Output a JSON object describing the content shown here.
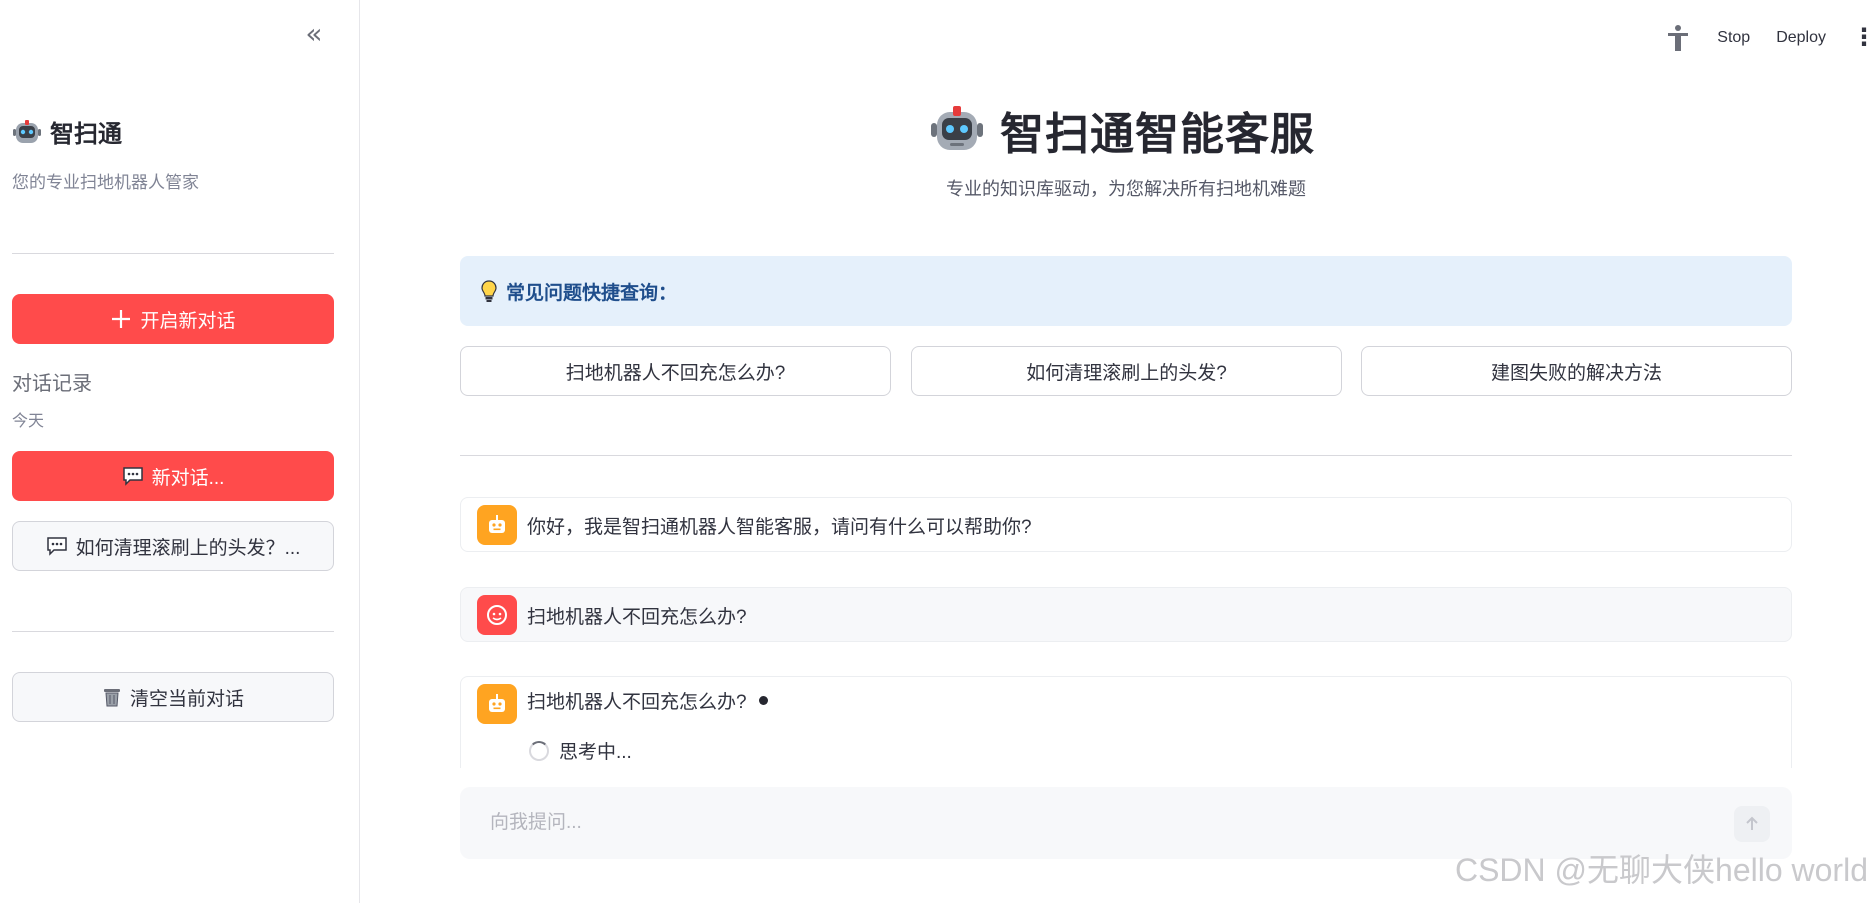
{
  "sidebar": {
    "collapse_glyph": "«",
    "brand_title": "智扫通",
    "brand_subtitle": "您的专业扫地机器人管家",
    "new_chat_button": "开启新对话",
    "history_title": "对话记录",
    "history_group": "今天",
    "history_items": [
      "新对话...",
      "如何清理滚刷上的头发？..."
    ],
    "clear_button": "清空当前对话"
  },
  "topbar": {
    "stop_label": "Stop",
    "deploy_label": "Deploy"
  },
  "main": {
    "title": "智扫通智能客服",
    "subtitle": "专业的知识库驱动，为您解决所有扫地机难题",
    "faq_header": "常见问题快捷查询：",
    "faq_buttons": [
      "扫地机器人不回充怎么办?",
      "如何清理滚刷上的头发?",
      "建图失败的解决方法"
    ]
  },
  "messages": [
    {
      "role": "assistant",
      "text": "你好，我是智扫通机器人智能客服，请问有什么可以帮助你?"
    },
    {
      "role": "user",
      "text": "扫地机器人不回充怎么办?"
    },
    {
      "role": "assistant",
      "text": "扫地机器人不回充怎么办?",
      "status": "思考中..."
    }
  ],
  "chat_input": {
    "placeholder": "向我提问..."
  },
  "watermark": "CSDN @无聊大侠hello world",
  "colors": {
    "primary": "#ff4b4b",
    "assistant_avatar": "#ffa421",
    "user_avatar": "#ff4b4b",
    "faq_bg": "#e5f0fb",
    "faq_text": "#1f4e8c"
  },
  "icons": {
    "collapse": "double-chevron-left-icon",
    "brand": "robot-face-icon",
    "new_chat": "plus-icon",
    "history_item": "speech-bubble-icon",
    "clear": "trash-can-icon",
    "accessibility": "accessibility-figure-icon",
    "more": "kebab-menu-icon",
    "faq": "lightbulb-icon",
    "assistant": "robot-icon",
    "user": "smiley-face-icon",
    "send": "arrow-up-icon"
  }
}
